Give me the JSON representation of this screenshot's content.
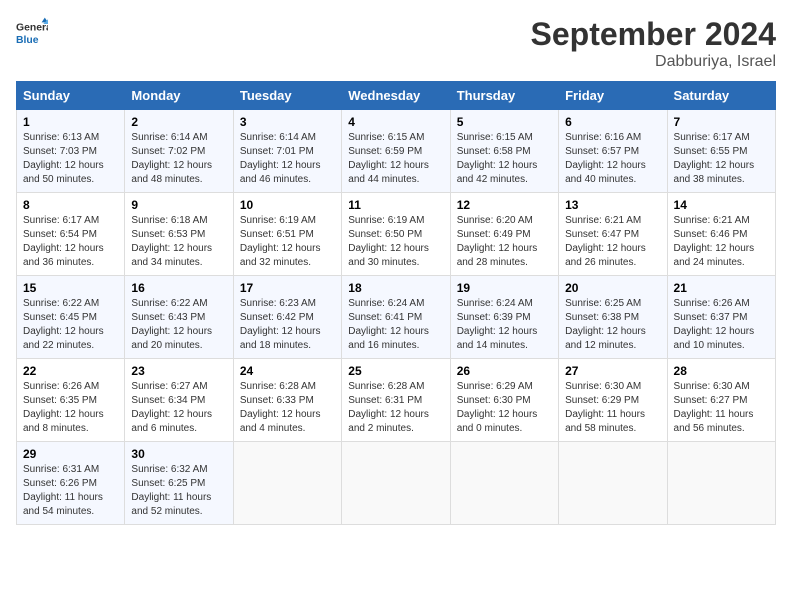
{
  "header": {
    "logo_line1": "General",
    "logo_line2": "Blue",
    "month_title": "September 2024",
    "location": "Dabburiya, Israel"
  },
  "days_of_week": [
    "Sunday",
    "Monday",
    "Tuesday",
    "Wednesday",
    "Thursday",
    "Friday",
    "Saturday"
  ],
  "weeks": [
    [
      {
        "num": "1",
        "sunrise": "6:13 AM",
        "sunset": "7:03 PM",
        "daylight": "12 hours and 50 minutes."
      },
      {
        "num": "2",
        "sunrise": "6:14 AM",
        "sunset": "7:02 PM",
        "daylight": "12 hours and 48 minutes."
      },
      {
        "num": "3",
        "sunrise": "6:14 AM",
        "sunset": "7:01 PM",
        "daylight": "12 hours and 46 minutes."
      },
      {
        "num": "4",
        "sunrise": "6:15 AM",
        "sunset": "6:59 PM",
        "daylight": "12 hours and 44 minutes."
      },
      {
        "num": "5",
        "sunrise": "6:15 AM",
        "sunset": "6:58 PM",
        "daylight": "12 hours and 42 minutes."
      },
      {
        "num": "6",
        "sunrise": "6:16 AM",
        "sunset": "6:57 PM",
        "daylight": "12 hours and 40 minutes."
      },
      {
        "num": "7",
        "sunrise": "6:17 AM",
        "sunset": "6:55 PM",
        "daylight": "12 hours and 38 minutes."
      }
    ],
    [
      {
        "num": "8",
        "sunrise": "6:17 AM",
        "sunset": "6:54 PM",
        "daylight": "12 hours and 36 minutes."
      },
      {
        "num": "9",
        "sunrise": "6:18 AM",
        "sunset": "6:53 PM",
        "daylight": "12 hours and 34 minutes."
      },
      {
        "num": "10",
        "sunrise": "6:19 AM",
        "sunset": "6:51 PM",
        "daylight": "12 hours and 32 minutes."
      },
      {
        "num": "11",
        "sunrise": "6:19 AM",
        "sunset": "6:50 PM",
        "daylight": "12 hours and 30 minutes."
      },
      {
        "num": "12",
        "sunrise": "6:20 AM",
        "sunset": "6:49 PM",
        "daylight": "12 hours and 28 minutes."
      },
      {
        "num": "13",
        "sunrise": "6:21 AM",
        "sunset": "6:47 PM",
        "daylight": "12 hours and 26 minutes."
      },
      {
        "num": "14",
        "sunrise": "6:21 AM",
        "sunset": "6:46 PM",
        "daylight": "12 hours and 24 minutes."
      }
    ],
    [
      {
        "num": "15",
        "sunrise": "6:22 AM",
        "sunset": "6:45 PM",
        "daylight": "12 hours and 22 minutes."
      },
      {
        "num": "16",
        "sunrise": "6:22 AM",
        "sunset": "6:43 PM",
        "daylight": "12 hours and 20 minutes."
      },
      {
        "num": "17",
        "sunrise": "6:23 AM",
        "sunset": "6:42 PM",
        "daylight": "12 hours and 18 minutes."
      },
      {
        "num": "18",
        "sunrise": "6:24 AM",
        "sunset": "6:41 PM",
        "daylight": "12 hours and 16 minutes."
      },
      {
        "num": "19",
        "sunrise": "6:24 AM",
        "sunset": "6:39 PM",
        "daylight": "12 hours and 14 minutes."
      },
      {
        "num": "20",
        "sunrise": "6:25 AM",
        "sunset": "6:38 PM",
        "daylight": "12 hours and 12 minutes."
      },
      {
        "num": "21",
        "sunrise": "6:26 AM",
        "sunset": "6:37 PM",
        "daylight": "12 hours and 10 minutes."
      }
    ],
    [
      {
        "num": "22",
        "sunrise": "6:26 AM",
        "sunset": "6:35 PM",
        "daylight": "12 hours and 8 minutes."
      },
      {
        "num": "23",
        "sunrise": "6:27 AM",
        "sunset": "6:34 PM",
        "daylight": "12 hours and 6 minutes."
      },
      {
        "num": "24",
        "sunrise": "6:28 AM",
        "sunset": "6:33 PM",
        "daylight": "12 hours and 4 minutes."
      },
      {
        "num": "25",
        "sunrise": "6:28 AM",
        "sunset": "6:31 PM",
        "daylight": "12 hours and 2 minutes."
      },
      {
        "num": "26",
        "sunrise": "6:29 AM",
        "sunset": "6:30 PM",
        "daylight": "12 hours and 0 minutes."
      },
      {
        "num": "27",
        "sunrise": "6:30 AM",
        "sunset": "6:29 PM",
        "daylight": "11 hours and 58 minutes."
      },
      {
        "num": "28",
        "sunrise": "6:30 AM",
        "sunset": "6:27 PM",
        "daylight": "11 hours and 56 minutes."
      }
    ],
    [
      {
        "num": "29",
        "sunrise": "6:31 AM",
        "sunset": "6:26 PM",
        "daylight": "11 hours and 54 minutes."
      },
      {
        "num": "30",
        "sunrise": "6:32 AM",
        "sunset": "6:25 PM",
        "daylight": "11 hours and 52 minutes."
      },
      null,
      null,
      null,
      null,
      null
    ]
  ]
}
